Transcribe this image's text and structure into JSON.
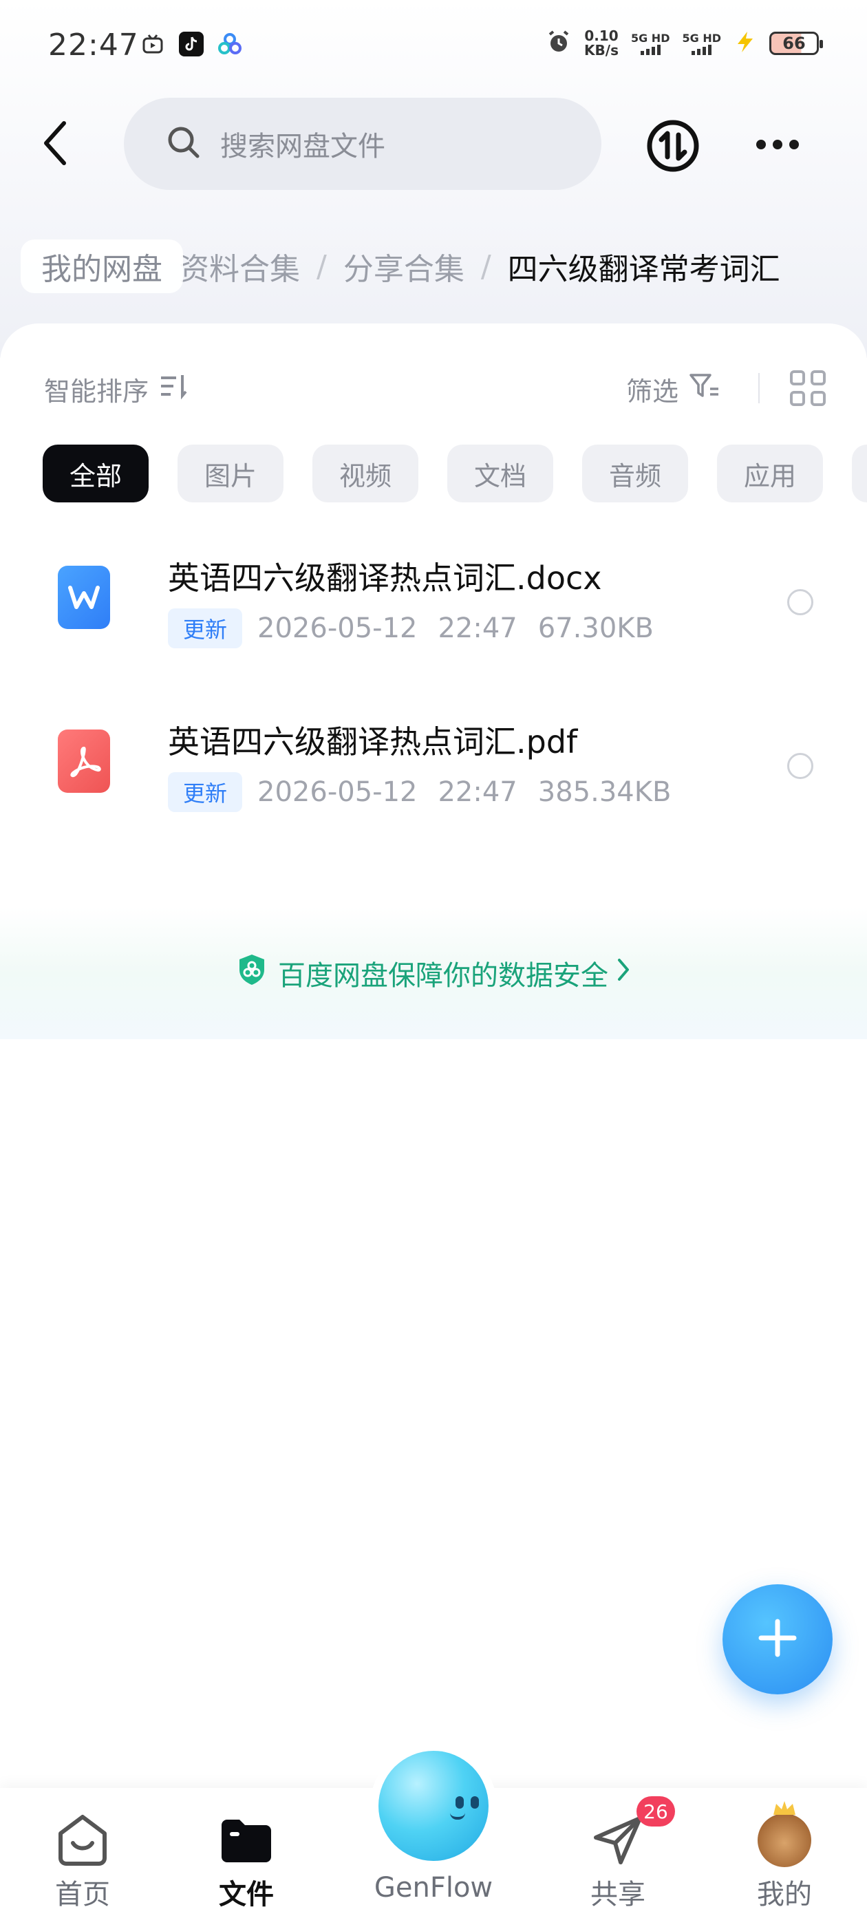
{
  "status_bar": {
    "time": "22:47",
    "net_speed_value": "0.10",
    "net_speed_unit": "KB/s",
    "signal_1": "5G HD",
    "signal_2": "5G HD",
    "battery": "66",
    "icons": [
      "bilibili-tv-icon",
      "tiktok-icon",
      "baidu-netdisk-icon",
      "alarm-icon",
      "charging-icon"
    ]
  },
  "header": {
    "search_placeholder": "搜索网盘文件",
    "icons": [
      "back-arrow-icon",
      "search-icon",
      "transfer-icon",
      "more-icon"
    ]
  },
  "breadcrumb": {
    "root": "我的网盘",
    "items": [
      "资料合集",
      "分享合集"
    ],
    "current": "四六级翻译常考词汇",
    "separator": "/"
  },
  "toolbar": {
    "sort_label": "智能排序",
    "filter_label": "筛选"
  },
  "filter_chips": [
    "全部",
    "图片",
    "视频",
    "文档",
    "音频",
    "应用"
  ],
  "files": [
    {
      "name": "英语四六级翻译热点词汇.docx",
      "badge": "更新",
      "date": "2026-05-12",
      "time": "22:47",
      "size": "67.30KB",
      "icon": "word-doc-icon"
    },
    {
      "name": "英语四六级翻译热点词汇.pdf",
      "badge": "更新",
      "date": "2026-05-12",
      "time": "22:47",
      "size": "385.34KB",
      "icon": "pdf-icon"
    }
  ],
  "security_notice": "百度网盘保障你的数据安全",
  "bottom_nav": {
    "home": "首页",
    "files": "文件",
    "genflow": "GenFlow",
    "share": "共享",
    "share_badge": "26",
    "me": "我的"
  },
  "colors": {
    "accent_blue": "#2f7ef7",
    "security_green": "#1aa37a",
    "badge_red": "#f23f5d",
    "active_chip": "#0b0c10"
  }
}
